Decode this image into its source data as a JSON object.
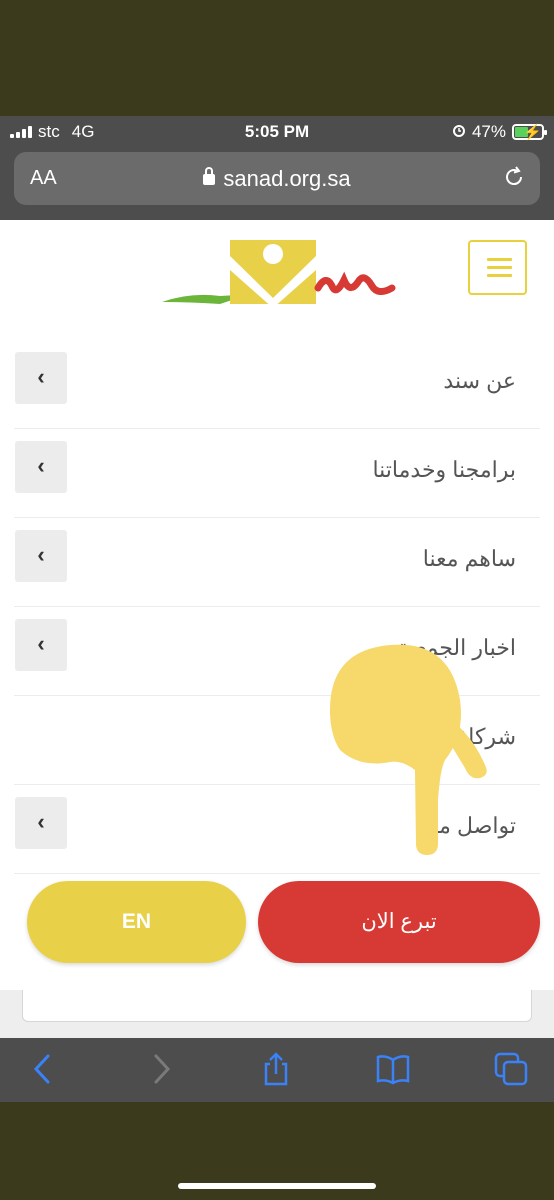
{
  "status_bar": {
    "carrier": "stc",
    "network": "4G",
    "time": "5:05 PM",
    "battery_percent": "47%",
    "battery_level": 0.47
  },
  "browser": {
    "text_size_label": "AA",
    "domain": "sanad.org.sa"
  },
  "header": {
    "logo_icon": "sanad-logo",
    "menu_icon": "hamburger-menu-icon"
  },
  "menu": {
    "items": [
      {
        "label": "عن سند",
        "has_submenu": true
      },
      {
        "label": "برامجنا وخدماتنا",
        "has_submenu": true
      },
      {
        "label": "ساهم معنا",
        "has_submenu": true
      },
      {
        "label": "اخبار الجمعية",
        "has_submenu": true
      },
      {
        "label": "شركاؤنا",
        "has_submenu": false
      },
      {
        "label": "تواصل معنا",
        "has_submenu": true
      }
    ],
    "chevron_glyph": "‹"
  },
  "actions": {
    "language_label": "EN",
    "donate_label": "تبرع الان"
  },
  "colors": {
    "accent_yellow": "#e8d148",
    "donate_red": "#d73a35",
    "logo_green": "#6bb53a"
  }
}
